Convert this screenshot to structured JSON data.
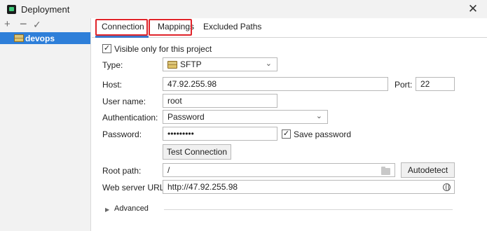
{
  "window": {
    "title": "Deployment",
    "close_label": "✕"
  },
  "sidebar": {
    "add_label": "+",
    "remove_label": "−",
    "apply_label": "✓",
    "items": [
      {
        "label": "devops",
        "icon": "server-icon"
      }
    ]
  },
  "tabs": [
    {
      "label": "Connection",
      "active": true,
      "highlighted": true
    },
    {
      "label": "Mappings",
      "active": false,
      "highlighted": true
    },
    {
      "label": "Excluded Paths",
      "active": false,
      "highlighted": false
    }
  ],
  "form": {
    "visible_only": {
      "label": "Visible only for this project",
      "checked": true
    },
    "type": {
      "label": "Type:",
      "value": "SFTP",
      "icon": "server-icon"
    },
    "host": {
      "label": "Host:",
      "value": "47.92.255.98"
    },
    "port": {
      "label": "Port:",
      "value": "22"
    },
    "user": {
      "label": "User name:",
      "value": "root"
    },
    "authentication": {
      "label": "Authentication:",
      "value": "Password"
    },
    "password": {
      "label": "Password:",
      "value": "•••••••••"
    },
    "save_password": {
      "label": "Save password",
      "checked": true
    },
    "test_connection": {
      "label": "Test Connection"
    },
    "root_path": {
      "label": "Root path:",
      "value": "/"
    },
    "autodetect": {
      "label": "Autodetect"
    },
    "web_server_url": {
      "label": "Web server URL:",
      "value": "http://47.92.255.98"
    },
    "advanced": {
      "label": "Advanced",
      "expanded": false
    }
  },
  "colors": {
    "selection": "#2e7fd9",
    "highlight_box": "#e0242a",
    "tab_underline": "#3b76c9"
  }
}
